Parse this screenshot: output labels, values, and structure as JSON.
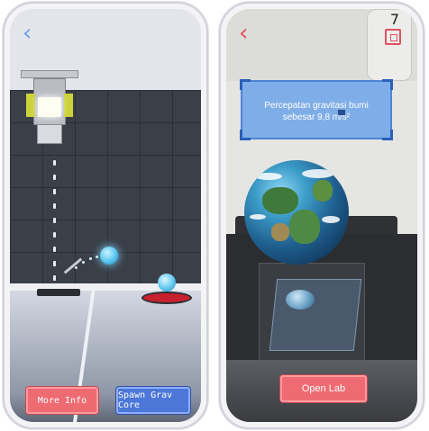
{
  "left_screen": {
    "back_icon": "chevron-left-icon",
    "buttons": {
      "more_info": "More Info",
      "spawn_grav_core": "Spawn Grav Core"
    },
    "colors": {
      "red_button": "#ef6b72",
      "blue_button": "#4c76d8",
      "back_icon": "#6e9ff0"
    }
  },
  "right_screen": {
    "back_icon": "chevron-left-icon",
    "capture_icon": "camera-frame-icon",
    "top_right_number": "7",
    "info_card": {
      "text": "Percepatan gravitasi bumi sebesar 9,8 m/s²"
    },
    "buttons": {
      "open_lab": "Open Lab"
    },
    "colors": {
      "card": "#68a0e8",
      "button": "#ef6b72",
      "back_icon": "#e0535d"
    }
  }
}
